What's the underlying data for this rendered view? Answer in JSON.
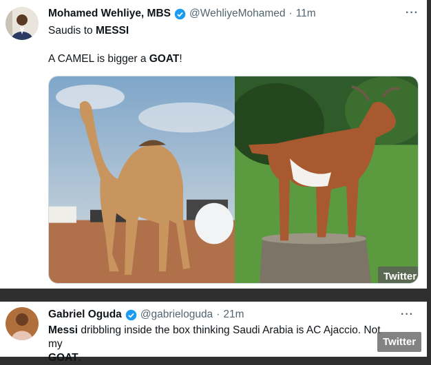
{
  "tweet1": {
    "name": "Mohamed Wehliye, MBS",
    "handle": "@WehliyeMohamed",
    "separator": "·",
    "time": "11m",
    "line1_plain": "Saudis to ",
    "line1_bold": "MESSI",
    "line2_plain_a": "A CAMEL is bigger a ",
    "line2_bold": "GOAT",
    "line2_plain_b": "!",
    "more": "···"
  },
  "tweet2": {
    "name": "Gabriel Oguda",
    "handle": "@gabrieloguda",
    "separator": "·",
    "time": "21m",
    "text_bold_a": "Messi",
    "text_plain": " dribbling inside the box thinking Saudi Arabia is AC Ajaccio. Not my",
    "text_bold_b": "GOAT",
    "text_end": ".",
    "more": "···"
  },
  "watermark": "Twitter",
  "colors": {
    "verified": "#1d9bf0",
    "secondary": "#536471"
  }
}
